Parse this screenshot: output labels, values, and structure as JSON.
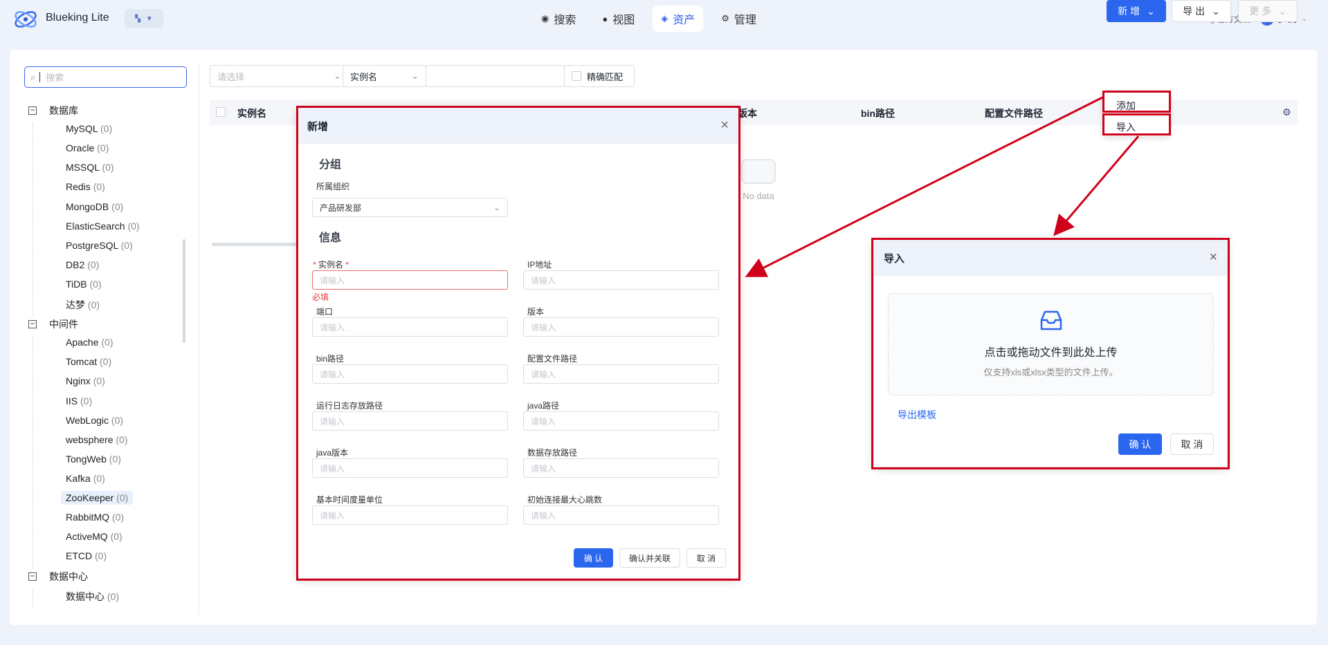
{
  "header": {
    "app_name": "Blueking Lite",
    "nav": [
      {
        "label": "搜索",
        "icon": "search-icon"
      },
      {
        "label": "视图",
        "icon": "view-icon"
      },
      {
        "label": "资产",
        "icon": "layers-icon"
      },
      {
        "label": "管理",
        "icon": "manage-icon"
      }
    ],
    "docs_label": "官方文档",
    "user_initial": "罗",
    "user_name": "罗扬"
  },
  "sidebar": {
    "search_placeholder": "搜索",
    "groups": [
      {
        "label": "数据库",
        "items": [
          {
            "label": "MySQL",
            "count": "(0)"
          },
          {
            "label": "Oracle",
            "count": "(0)"
          },
          {
            "label": "MSSQL",
            "count": "(0)"
          },
          {
            "label": "Redis",
            "count": "(0)"
          },
          {
            "label": "MongoDB",
            "count": "(0)"
          },
          {
            "label": "ElasticSearch",
            "count": "(0)"
          },
          {
            "label": "PostgreSQL",
            "count": "(0)"
          },
          {
            "label": "DB2",
            "count": "(0)"
          },
          {
            "label": "TiDB",
            "count": "(0)"
          },
          {
            "label": "达梦",
            "count": "(0)"
          }
        ]
      },
      {
        "label": "中间件",
        "items": [
          {
            "label": "Apache",
            "count": "(0)"
          },
          {
            "label": "Tomcat",
            "count": "(0)"
          },
          {
            "label": "Nginx",
            "count": "(0)"
          },
          {
            "label": "IIS",
            "count": "(0)"
          },
          {
            "label": "WebLogic",
            "count": "(0)"
          },
          {
            "label": "websphere",
            "count": "(0)"
          },
          {
            "label": "TongWeb",
            "count": "(0)"
          },
          {
            "label": "Kafka",
            "count": "(0)"
          },
          {
            "label": "ZooKeeper",
            "count": "(0)"
          },
          {
            "label": "RabbitMQ",
            "count": "(0)"
          },
          {
            "label": "ActiveMQ",
            "count": "(0)"
          },
          {
            "label": "ETCD",
            "count": "(0)"
          }
        ]
      },
      {
        "label": "数据中心",
        "items": [
          {
            "label": "数据中心",
            "count": "(0)"
          }
        ]
      }
    ]
  },
  "toolbar": {
    "select_placeholder": "请选择",
    "field_select": "实例名",
    "exact_match": "精确匹配",
    "add_label": "新 增",
    "export_label": "导 出",
    "more_label": "更 多"
  },
  "table": {
    "columns": [
      "实例名",
      "版本",
      "bin路径",
      "配置文件路径"
    ],
    "empty_text": "No data"
  },
  "add_menu": {
    "items": [
      "添加",
      "导入"
    ]
  },
  "add_dialog": {
    "title": "新增",
    "group_section": "分组",
    "org_label": "所属组织",
    "org_value": "产品研发部",
    "info_section": "信息",
    "fields": [
      {
        "label": "实例名",
        "placeholder": "请输入"
      },
      {
        "label": "IP地址",
        "placeholder": "请输入"
      },
      {
        "label": "端口",
        "placeholder": "请输入"
      },
      {
        "label": "版本",
        "placeholder": "请输入"
      },
      {
        "label": "bin路径",
        "placeholder": "请输入"
      },
      {
        "label": "配置文件路径",
        "placeholder": "请输入"
      },
      {
        "label": "运行日志存放路径",
        "placeholder": "请输入"
      },
      {
        "label": "java路径",
        "placeholder": "请输入"
      },
      {
        "label": "java版本",
        "placeholder": "请输入"
      },
      {
        "label": "数据存放路径",
        "placeholder": "请输入"
      },
      {
        "label": "基本时间度量单位",
        "placeholder": "请输入"
      },
      {
        "label": "初始连接最大心跳数",
        "placeholder": "请输入"
      }
    ],
    "required_msg": "必填",
    "confirm": "确 认",
    "confirm_link": "确认并关联",
    "cancel": "取 消"
  },
  "import_dialog": {
    "title": "导入",
    "upload_title": "点击或拖动文件到此处上传",
    "upload_hint": "仅支持xls或xlsx类型的文件上传。",
    "template_link": "导出模板",
    "confirm": "确 认",
    "cancel": "取 消"
  },
  "colors": {
    "accent": "#2a66ee",
    "annotation": "#d0021b",
    "error": "#e63c3c"
  }
}
